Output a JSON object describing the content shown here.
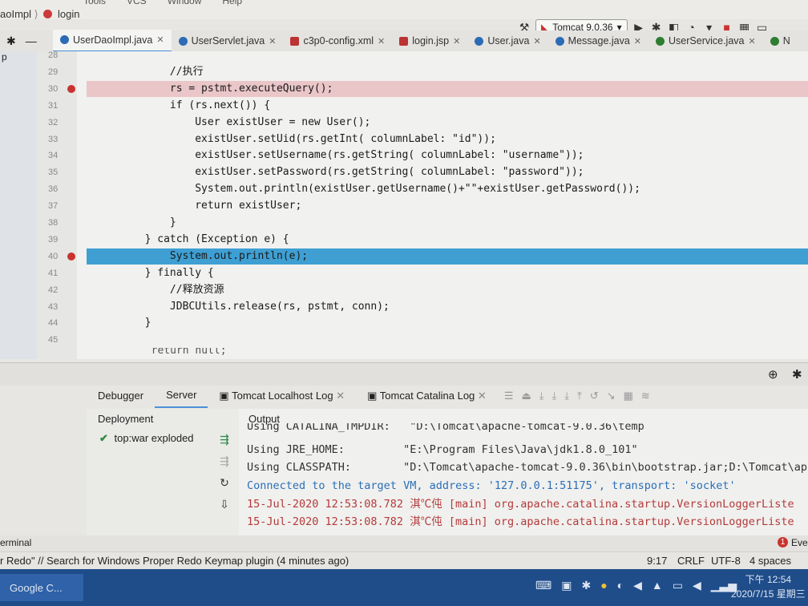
{
  "window": {
    "breadcrumb_file": "aoImpl",
    "breadcrumb_method": "login",
    "menu_items": [
      "Tools",
      "VCS",
      "Window",
      "Help"
    ]
  },
  "toolbar": {
    "run_config": "Tomcat 9.0.36"
  },
  "tabs": [
    {
      "label": "UserDaoImpl.java",
      "active": true,
      "icon": "class-icon"
    },
    {
      "label": "UserServlet.java",
      "icon": "class-icon"
    },
    {
      "label": "c3p0-config.xml",
      "icon": "xml-icon"
    },
    {
      "label": "login.jsp",
      "icon": "jsp-icon"
    },
    {
      "label": "User.java",
      "icon": "class-icon"
    },
    {
      "label": "Message.java",
      "icon": "class-icon"
    },
    {
      "label": "UserService.java",
      "icon": "interface-icon"
    },
    {
      "label": "N",
      "icon": "interface-icon"
    }
  ],
  "editor": {
    "project_label": "p",
    "lines": [
      {
        "num": "28",
        "code": ""
      },
      {
        "num": "29",
        "code": "            //执行"
      },
      {
        "num": "30",
        "code": "            rs = pstmt.executeQuery();",
        "breakpoint": true
      },
      {
        "num": "31",
        "code": "            if (rs.next()) {"
      },
      {
        "num": "32",
        "code": "                User existUser = new User();"
      },
      {
        "num": "33",
        "code": "                existUser.setUid(rs.getInt( columnLabel: \"id\"));"
      },
      {
        "num": "34",
        "code": "                existUser.setUsername(rs.getString( columnLabel: \"username\"));"
      },
      {
        "num": "35",
        "code": "                existUser.setPassword(rs.getString( columnLabel: \"password\"));"
      },
      {
        "num": "36",
        "code": "                System.out.println(existUser.getUsername()+\"\"+existUser.getPassword());"
      },
      {
        "num": "37",
        "code": "                return existUser;"
      },
      {
        "num": "38",
        "code": "            }"
      },
      {
        "num": "39",
        "code": "        } catch (Exception e) {"
      },
      {
        "num": "40",
        "code": "            System.out.println(e);",
        "breakpoint": true,
        "execution": true
      },
      {
        "num": "41",
        "code": "        } finally {"
      },
      {
        "num": "42",
        "code": "            //释放资源"
      },
      {
        "num": "43",
        "code": "            JDBCUtils.release(rs, pstmt, conn);"
      },
      {
        "num": "44",
        "code": "        }"
      },
      {
        "num": "45",
        "code": ""
      }
    ],
    "trailing_partial": "        return null;"
  },
  "debug_panel": {
    "tabs": [
      "Debugger",
      "Server",
      "Tomcat Localhost Log",
      "Tomcat Catalina Log"
    ],
    "active_tab": "Server",
    "deployment_header": "Deployment",
    "deployment_item": "top:war exploded",
    "output_header": "Output",
    "output_lines": [
      {
        "text": "Using CATALINA_TMPDIR:   \"D:\\Tomcat\\apache-tomcat-9.0.36\\temp",
        "style": "normal"
      },
      {
        "text": "Using JRE_HOME:         \"E:\\Program Files\\Java\\jdk1.8.0_101\"",
        "style": "normal"
      },
      {
        "text": "Using CLASSPATH:        \"D:\\Tomcat\\apache-tomcat-9.0.36\\bin\\bootstrap.jar;D:\\Tomcat\\ap",
        "style": "normal"
      },
      {
        "text": "Connected to the target VM, address: '127.0.0.1:51175', transport: 'socket'",
        "style": "blue"
      },
      {
        "text": "15-Jul-2020 12:53:08.782 淇℃伅 [main] org.apache.catalina.startup.VersionLoggerListe",
        "style": "red"
      },
      {
        "text": "15-Jul-2020 12:53:08.782 淇℃伅 [main] org.apache.catalina.startup.VersionLoggerListe",
        "style": "red"
      }
    ]
  },
  "tool_window_bar": {
    "left_label": "erminal",
    "right_label": "Eve",
    "right_badge": "1"
  },
  "status_bar": {
    "message": "r Redo\" // Search for Windows Proper Redo Keymap plugin (4 minutes ago)",
    "position": "9:17",
    "line_sep": "CRLF",
    "encoding": "UTF-8",
    "indent": "4 spaces"
  },
  "taskbar": {
    "app_label": "Google C...",
    "time": "下午 12:54",
    "date": "2020/7/15 星期三"
  }
}
